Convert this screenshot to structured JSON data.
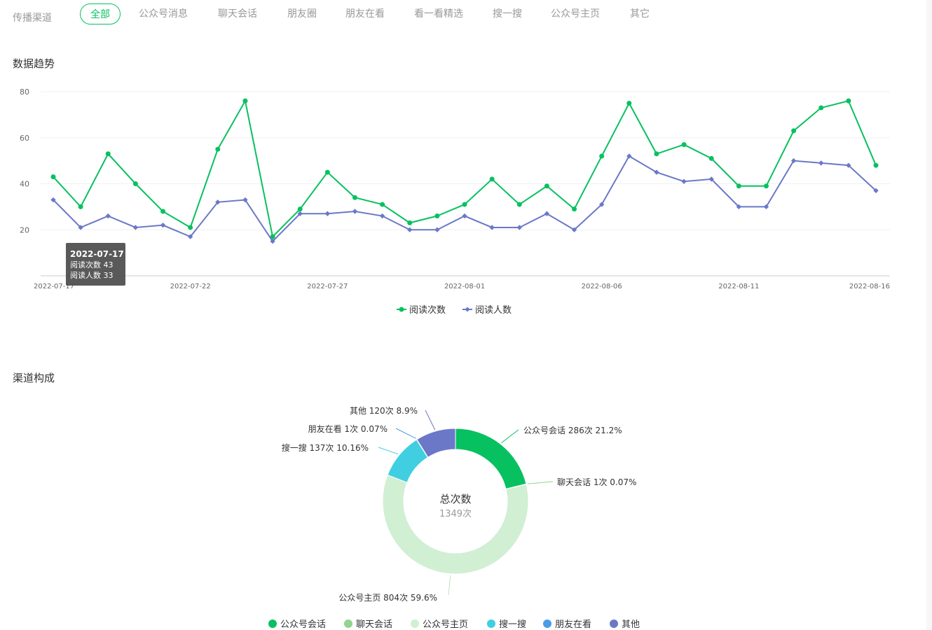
{
  "tabs_bar": {
    "label": "传播渠道",
    "items": [
      "全部",
      "公众号消息",
      "聊天会话",
      "朋友圈",
      "朋友在看",
      "看一看精选",
      "搜一搜",
      "公众号主页",
      "其它"
    ],
    "active_index": 0
  },
  "trend": {
    "title": "数据趋势"
  },
  "composition": {
    "title": "渠道构成"
  },
  "colors": {
    "accent": "#07c160",
    "reads": "#07c160",
    "readers": "#6b78c8"
  },
  "chart_data": [
    {
      "type": "line",
      "title": "",
      "x": [
        "2022-07-17",
        "2022-07-18",
        "2022-07-19",
        "2022-07-20",
        "2022-07-21",
        "2022-07-22",
        "2022-07-23",
        "2022-07-24",
        "2022-07-25",
        "2022-07-26",
        "2022-07-27",
        "2022-07-28",
        "2022-07-29",
        "2022-07-30",
        "2022-07-31",
        "2022-08-01",
        "2022-08-02",
        "2022-08-03",
        "2022-08-04",
        "2022-08-05",
        "2022-08-06",
        "2022-08-07",
        "2022-08-08",
        "2022-08-09",
        "2022-08-10",
        "2022-08-11",
        "2022-08-12",
        "2022-08-13",
        "2022-08-14",
        "2022-08-15",
        "2022-08-16"
      ],
      "x_tick_labels": [
        "2022-07-17",
        "2022-07-22",
        "2022-07-27",
        "2022-08-01",
        "2022-08-06",
        "2022-08-11",
        "2022-08-16"
      ],
      "series": [
        {
          "name": "阅读次数",
          "values": [
            43,
            30,
            53,
            40,
            28,
            21,
            55,
            76,
            17,
            29,
            45,
            34,
            31,
            23,
            26,
            31,
            42,
            31,
            39,
            29,
            52,
            75,
            53,
            57,
            51,
            39,
            39,
            63,
            73,
            76,
            48
          ]
        },
        {
          "name": "阅读人数",
          "values": [
            33,
            21,
            26,
            21,
            22,
            17,
            32,
            33,
            15,
            27,
            27,
            28,
            26,
            20,
            20,
            26,
            21,
            21,
            27,
            20,
            31,
            52,
            45,
            41,
            42,
            30,
            30,
            50,
            49,
            48,
            37
          ]
        }
      ],
      "ylim": [
        0,
        80
      ],
      "y_ticks": [
        20,
        40,
        60,
        80
      ],
      "grid": true,
      "legend": "bottom-center",
      "tooltip": {
        "date": "2022-07-17",
        "lines": [
          "阅读次数 43",
          "阅读人数 33"
        ]
      }
    },
    {
      "type": "pie",
      "title": "",
      "center_title": "总次数",
      "center_value": "1349次",
      "slices": [
        {
          "name": "公众号会话",
          "value": 286,
          "label": "公众号会话 286次 21.2%",
          "color": "#07c160"
        },
        {
          "name": "聊天会话",
          "value": 1,
          "label": "聊天会话 1次 0.07%",
          "color": "#91d48f"
        },
        {
          "name": "公众号主页",
          "value": 804,
          "label": "公众号主页 804次 59.6%",
          "color": "#d1efd3"
        },
        {
          "name": "搜一搜",
          "value": 137,
          "label": "搜一搜 137次 10.16%",
          "color": "#3fcfe1"
        },
        {
          "name": "朋友在看",
          "value": 1,
          "label": "朋友在看 1次 0.07%",
          "color": "#4a9be8"
        },
        {
          "name": "其他",
          "value": 120,
          "label": "其他 120次 8.9%",
          "color": "#6b78c8"
        }
      ],
      "legend": "bottom-center"
    }
  ]
}
